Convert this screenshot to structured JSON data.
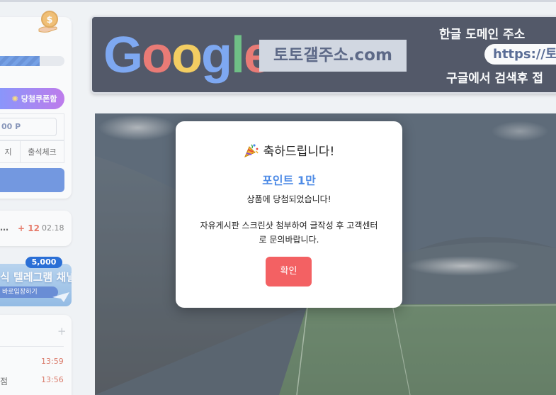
{
  "sidebar": {
    "progress_fraction": 0.62,
    "coupon_button": "당첨쿠폰함",
    "point_value": "00 P",
    "tabs": [
      "지",
      "출석체크"
    ],
    "ticker": {
      "prefix": "…",
      "badge": "+ 12",
      "date": "02.18"
    },
    "telegram": {
      "badge": "5,000",
      "title": "식 텔레그램 채널",
      "subtitle": "바로입장하기"
    },
    "list": {
      "times": [
        "13:59",
        "13:56"
      ],
      "fragment": "점"
    }
  },
  "banner": {
    "logo": [
      "G",
      "o",
      "o",
      "g",
      "l",
      "e"
    ],
    "domain": "토토갤주소.com",
    "line1": "한글 도메인 주소",
    "url": "https://토",
    "line3": "구글에서 검색후 접"
  },
  "modal": {
    "title": "축하드립니다!",
    "prize": "포인트 1만",
    "message": "상품에 당첨되었습니다!",
    "instruction": "자유게시판 스크린샷 첨부하여 글작성 후 고객센터로 문의바랍니다.",
    "confirm": "확인"
  },
  "colors": {
    "accent_blue": "#4e8be6",
    "confirm_red": "#f36163",
    "banner_bg": "#0b1328"
  }
}
